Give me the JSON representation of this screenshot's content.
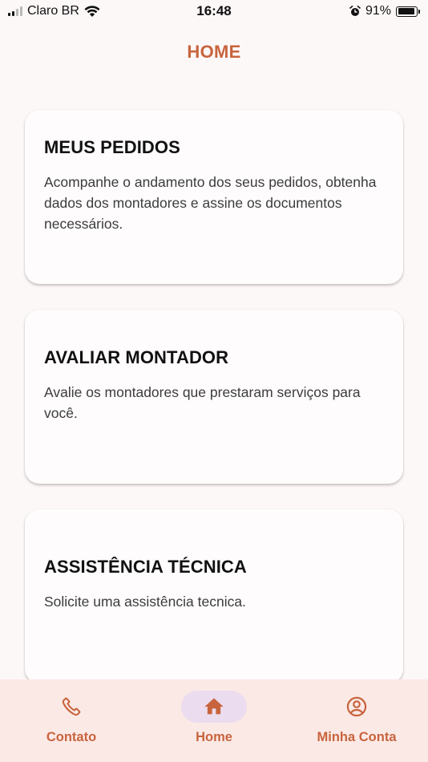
{
  "status_bar": {
    "carrier": "Claro BR",
    "time": "16:48",
    "battery": "91%",
    "battery_level": 0.91
  },
  "header": {
    "title": "HOME"
  },
  "cards": [
    {
      "title": "MEUS PEDIDOS",
      "description": "Acompanhe o andamento dos seus pedidos, obtenha dados dos montadores e assine os documentos necessários."
    },
    {
      "title": "AVALIAR MONTADOR",
      "description": "Avalie os montadores que prestaram serviços para você."
    },
    {
      "title": "ASSISTÊNCIA TÉCNICA",
      "description": "Solicite uma assistência tecnica."
    }
  ],
  "bottom_nav": {
    "items": [
      {
        "label": "Contato",
        "icon": "phone-icon",
        "active": false
      },
      {
        "label": "Home",
        "icon": "home-icon",
        "active": true
      },
      {
        "label": "Minha Conta",
        "icon": "account-circle-icon",
        "active": false
      }
    ]
  },
  "colors": {
    "accent": "#c8643d",
    "nav_bg": "#fbe9e6",
    "nav_active_pill": "#ecdcef",
    "background": "#fdf8f8"
  }
}
